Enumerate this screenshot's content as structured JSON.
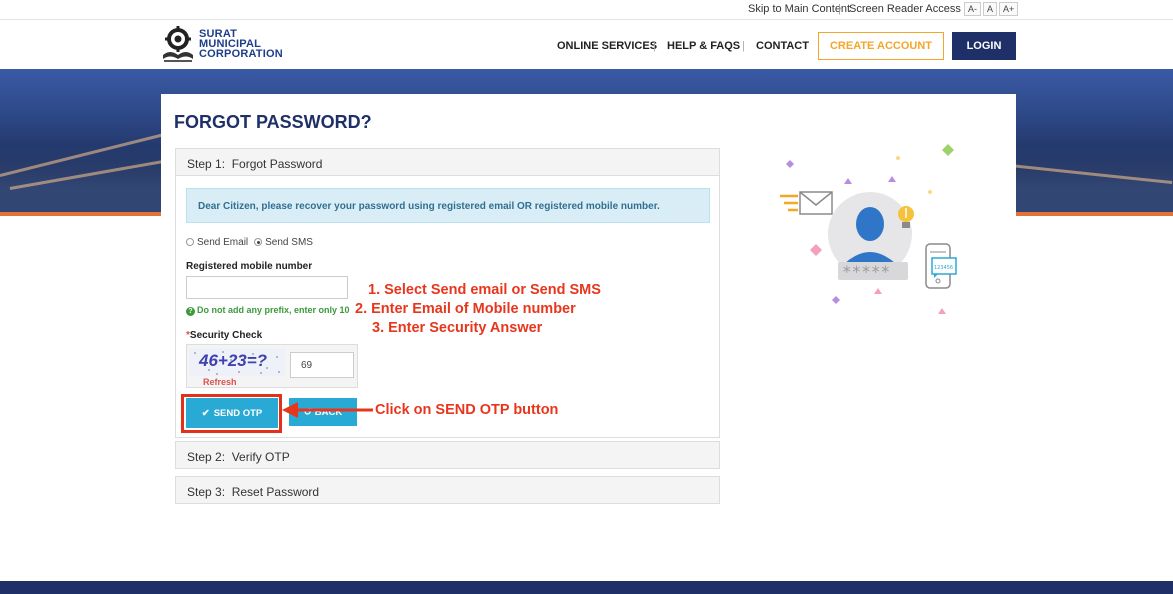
{
  "utility": {
    "skip_link": "Skip to Main Content",
    "screen_reader": "Screen Reader Access",
    "font_small": "A-",
    "font_normal": "A",
    "font_large": "A+"
  },
  "brand": {
    "line1": "SURAT",
    "line2": "MUNICIPAL",
    "line3": "CORPORATION",
    "color": "#1e3e8c"
  },
  "nav": {
    "online_services": "ONLINE SERVICES",
    "help_faqs": "HELP & FAQS",
    "contact": "CONTACT",
    "create_account": "CREATE ACCOUNT",
    "login": "LOGIN"
  },
  "page": {
    "title": "FORGOT PASSWORD?"
  },
  "steps": [
    {
      "num": "Step 1:",
      "label": "Forgot Password"
    },
    {
      "num": "Step 2:",
      "label": "Verify OTP"
    },
    {
      "num": "Step 3:",
      "label": "Reset Password"
    }
  ],
  "form": {
    "info": "Dear Citizen, please recover your password using registered email OR registered mobile number.",
    "option_email": "Send Email",
    "option_sms": "Send SMS",
    "selected_option": "Send SMS",
    "mobile_label": "Registered mobile number",
    "mobile_value": "",
    "hint": "Do not add any prefix, enter only 10",
    "security_required_mark": "*",
    "security_label": "Security Check",
    "captcha_text": "46+23=?",
    "refresh": "Refresh",
    "captcha_answer": "69",
    "send_otp": "SEND OTP",
    "back": "BACK"
  },
  "annotations": {
    "line1": "1. Select Send email or Send SMS",
    "line2": "2. Enter Email of Mobile number",
    "line3": "3. Enter Security Answer",
    "click_otp": "Click on SEND OTP button",
    "color": "#e8361d"
  },
  "illustration": {
    "password_mask": "*****",
    "phone_badge": "123456"
  },
  "colors": {
    "navy": "#1e3067",
    "orange": "#f4a52a",
    "button_blue": "#29aad4",
    "info_bg": "#d9edf7"
  }
}
